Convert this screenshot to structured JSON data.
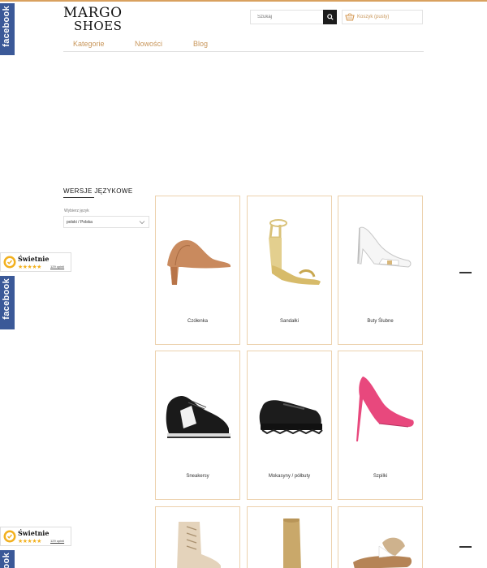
{
  "brand": {
    "logo_line1": "MARGO",
    "logo_line2": "SHOES"
  },
  "search": {
    "placeholder": "Szukaj"
  },
  "cart": {
    "label": "Koszyk (pusty)"
  },
  "nav": {
    "items": [
      "Kategorie",
      "Nowości",
      "Blog"
    ]
  },
  "sidebar": {
    "title": "WERSJE JĘZYKOWE",
    "language_label": "Wybierz język",
    "language_value": "polski / Polska"
  },
  "products": [
    {
      "name": "Czółenka"
    },
    {
      "name": "Sandałki"
    },
    {
      "name": "Buty Ślubne"
    },
    {
      "name": "Sneakersy"
    },
    {
      "name": "Mokasyny / półbuty"
    },
    {
      "name": "Szpilki"
    },
    {
      "name": ""
    },
    {
      "name": ""
    },
    {
      "name": ""
    }
  ],
  "widgets": {
    "facebook_label": "facebook",
    "review_title": "Świetnie",
    "review_stars": "★★★★★",
    "review_link": "129 opinii"
  },
  "colors": {
    "accent": "#c8965a",
    "facebook": "#3b5998",
    "card_border": "#ecd1ad"
  }
}
